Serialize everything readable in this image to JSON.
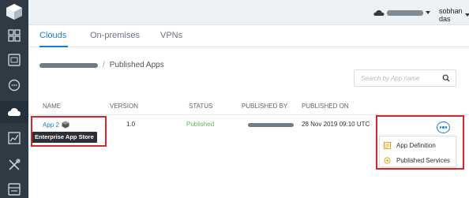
{
  "user": {
    "name": "sobhan das"
  },
  "tabs": [
    {
      "label": "Clouds",
      "active": true
    },
    {
      "label": "On-premises",
      "active": false
    },
    {
      "label": "VPNs",
      "active": false
    }
  ],
  "breadcrumb": {
    "current": "Published Apps",
    "separator": "/"
  },
  "search": {
    "placeholder": "Search by App name"
  },
  "table": {
    "columns": [
      "NAME",
      "VERSION",
      "STATUS",
      "PUBLISHED BY",
      "PUBLISHED ON"
    ],
    "rows": [
      {
        "name": "App 2",
        "version": "1.0",
        "status": "Published",
        "published_on": "28 Nov 2019 09:10 UTC"
      }
    ]
  },
  "tooltip": "Enterprise App Store",
  "menu": {
    "items": [
      "App Definition",
      "Published Services"
    ]
  },
  "colors": {
    "accent": "#1b7fcf",
    "success": "#5cb85c",
    "highlight": "#d9262c",
    "sidebar": "#2f3a45"
  },
  "icons": {
    "sidebar": [
      "logo-icon",
      "dashboard-icon",
      "apps-icon",
      "chat-icon",
      "cloud-icon",
      "chart-icon",
      "tools-icon",
      "server-icon"
    ],
    "menu": [
      "document-icon",
      "services-icon"
    ]
  }
}
